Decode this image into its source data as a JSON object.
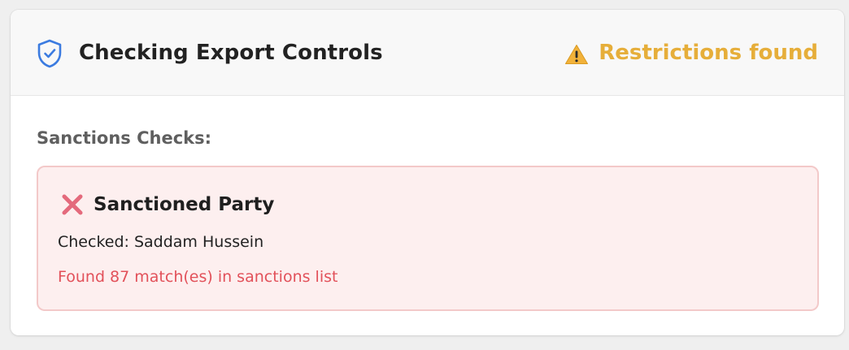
{
  "header": {
    "title": "Checking Export Controls",
    "title_icon": "shield-check-icon",
    "status": {
      "icon": "warning-icon",
      "label": "Restrictions found",
      "color": "#e6ae3a"
    }
  },
  "sanctions": {
    "section_label": "Sanctions Checks:",
    "items": [
      {
        "icon": "cross-mark-icon",
        "title": "Sanctioned Party",
        "checked_prefix": "Checked:",
        "checked_value": "Saddam Hussein",
        "result": "Found 87 match(es) in sanctions list",
        "result_color": "#e2515a"
      }
    ]
  },
  "colors": {
    "accent_blue": "#3b7be0",
    "warning": "#e6ae3a",
    "error": "#e2515a",
    "error_bg": "#fdefef",
    "error_border": "#f3c9c9"
  }
}
